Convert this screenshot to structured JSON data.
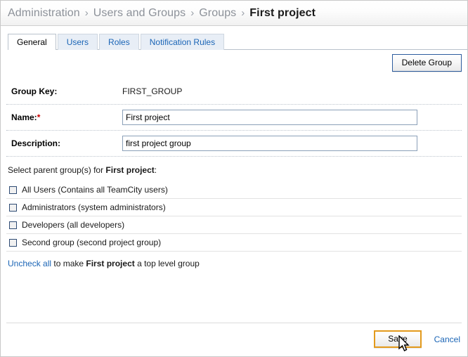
{
  "breadcrumb": {
    "separator": "›",
    "items": [
      {
        "label": "Administration",
        "current": false
      },
      {
        "label": "Users and Groups",
        "current": false
      },
      {
        "label": "Groups",
        "current": false
      },
      {
        "label": "First project",
        "current": true
      }
    ]
  },
  "tabs": [
    {
      "label": "General",
      "active": true
    },
    {
      "label": "Users",
      "active": false
    },
    {
      "label": "Roles",
      "active": false
    },
    {
      "label": "Notification Rules",
      "active": false
    }
  ],
  "toolbar": {
    "delete_group_label": "Delete Group"
  },
  "form": {
    "group_key": {
      "label": "Group Key:",
      "value": "FIRST_GROUP"
    },
    "name": {
      "label": "Name:",
      "required_marker": "*",
      "value": "First project",
      "placeholder": ""
    },
    "description": {
      "label": "Description:",
      "value": "first project group",
      "placeholder": ""
    }
  },
  "parent_groups": {
    "intro_prefix": "Select parent group(s) for ",
    "intro_bold": "First project",
    "intro_suffix": ":",
    "items": [
      {
        "label": "All Users (Contains all TeamCity users)",
        "checked": false
      },
      {
        "label": "Administrators (system administrators)",
        "checked": false
      },
      {
        "label": "Developers (all developers)",
        "checked": false
      },
      {
        "label": "Second group (second project group)",
        "checked": false
      }
    ],
    "uncheck_link": "Uncheck all",
    "uncheck_mid": " to make ",
    "uncheck_bold": "First project",
    "uncheck_suffix": " a top level group"
  },
  "footer": {
    "save_label": "Save",
    "cancel_label": "Cancel"
  },
  "colors": {
    "link": "#1b65b6",
    "required": "#cc0000",
    "save_border": "#e39a1c",
    "delete_border": "#2d5c9e",
    "checkbox_border": "#2d4a73"
  }
}
